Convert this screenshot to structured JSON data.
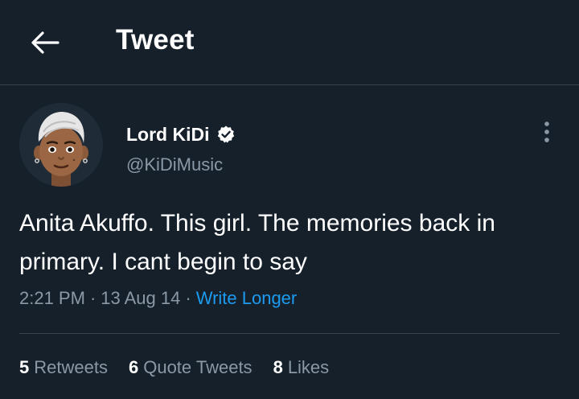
{
  "header": {
    "title": "Tweet",
    "back_icon": "arrow-left-icon"
  },
  "author": {
    "name": "Lord KiDi",
    "handle": "@KiDiMusic",
    "verified": true,
    "verified_icon": "verified-badge-icon",
    "more_icon": "more-vertical-icon"
  },
  "tweet": {
    "text": "Anita Akuffo. This girl. The memories back in primary. I cant begin to say",
    "time": "2:21 PM",
    "date": "13 Aug 14",
    "source": "Write Longer"
  },
  "stats": [
    {
      "count": "5",
      "label": "Retweets"
    },
    {
      "count": "6",
      "label": "Quote Tweets"
    },
    {
      "count": "8",
      "label": "Likes"
    }
  ],
  "colors": {
    "background": "#15202b",
    "text": "#ffffff",
    "secondary": "#8b98a5",
    "link": "#1d9bf0",
    "border": "#38444d"
  }
}
